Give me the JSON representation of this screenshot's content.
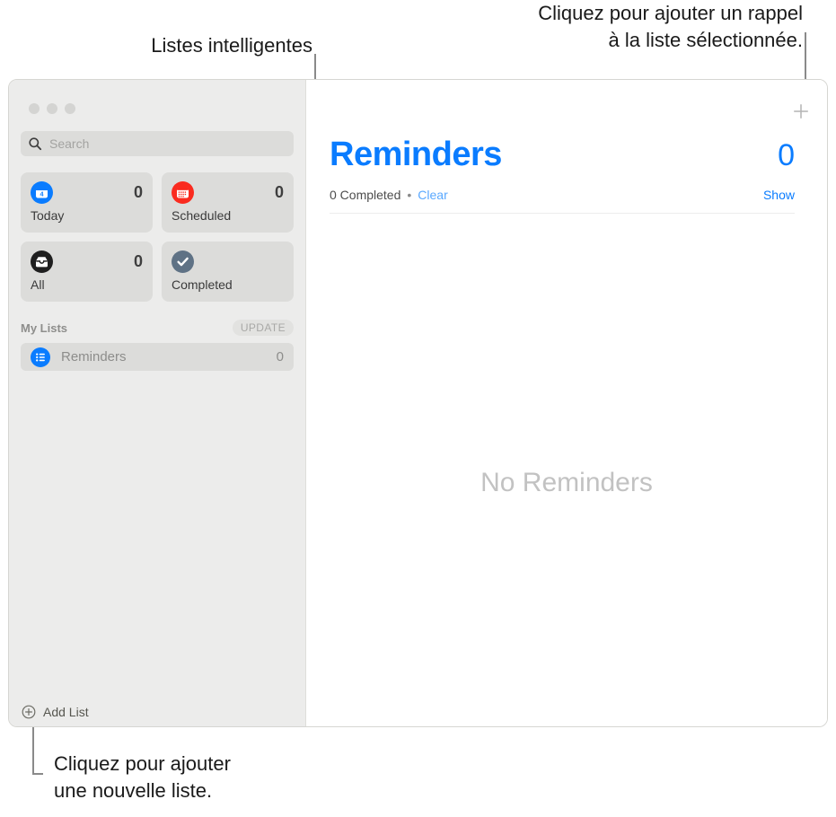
{
  "annotations": {
    "smart_lists": "Listes intelligentes",
    "add_reminder": "Cliquez pour ajouter un rappel\nà la liste sélectionnée.",
    "add_list": "Cliquez pour ajouter\nune nouvelle liste."
  },
  "window": {
    "traffic_lights": [
      "close",
      "minimize",
      "zoom"
    ]
  },
  "sidebar": {
    "search": {
      "placeholder": "Search",
      "value": "",
      "icon": "search-icon"
    },
    "smart_lists": [
      {
        "label": "Today",
        "count": "0",
        "icon": "calendar-today-icon",
        "icon_color": "#0a7cff",
        "glyph_text": "4"
      },
      {
        "label": "Scheduled",
        "count": "0",
        "icon": "calendar-scheduled-icon",
        "icon_color": "#fa2b1f"
      },
      {
        "label": "All",
        "count": "0",
        "icon": "inbox-tray-icon",
        "icon_color": "#1f1f1f"
      },
      {
        "label": "Completed",
        "count": "",
        "icon": "checkmark-icon",
        "icon_color": "#5f7285"
      }
    ],
    "my_lists": {
      "title": "My Lists",
      "badge": "UPDATE",
      "rows": [
        {
          "label": "Reminders",
          "count": "0",
          "icon": "bulleted-list-icon",
          "icon_color": "#0a7cff"
        }
      ]
    },
    "add_list": {
      "label": "Add List",
      "icon": "plus-circle-icon"
    }
  },
  "main": {
    "add_button_icon": "plus-icon",
    "title": "Reminders",
    "count": "0",
    "completed_text": "0 Completed",
    "separator_dot": "•",
    "clear_label": "Clear",
    "show_label": "Show",
    "empty_text": "No Reminders"
  },
  "colors": {
    "accent_blue": "#0a7cff",
    "link_blue_light": "#59a8ff",
    "today_blue": "#0a7cff",
    "scheduled_red": "#fa2b1f",
    "all_black": "#1f1f1f",
    "completed_slate": "#5f7285",
    "sidebar_bg": "#ececeb",
    "card_bg": "#dcdcda",
    "empty_gray": "#c2c2c2"
  }
}
